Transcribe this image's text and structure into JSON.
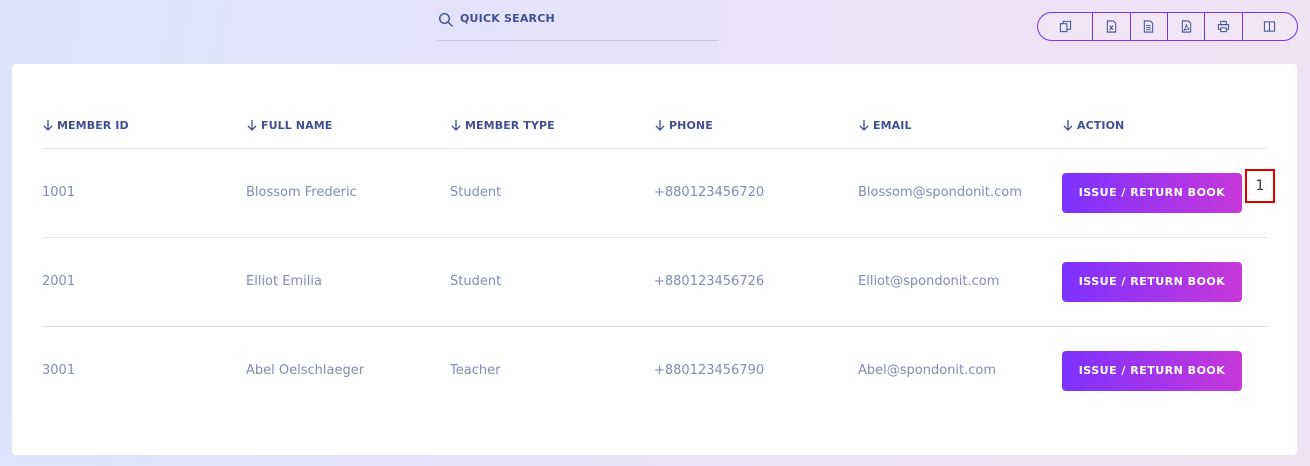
{
  "search": {
    "placeholder": "QUICK SEARCH"
  },
  "toolbar": {
    "buttons": [
      "copy-icon",
      "excel-icon",
      "csv-icon",
      "pdf-icon",
      "print-icon",
      "columns-icon"
    ]
  },
  "table": {
    "headers": [
      "MEMBER ID",
      "FULL NAME",
      "MEMBER TYPE",
      "PHONE",
      "EMAIL",
      "ACTION"
    ],
    "rows": [
      {
        "id": "1001",
        "name": "Blossom Frederic",
        "type": "Student",
        "phone": "+880123456720",
        "email": "Blossom@spondonit.com",
        "action": "ISSUE / RETURN BOOK"
      },
      {
        "id": "2001",
        "name": "Elliot Emilia",
        "type": "Student",
        "phone": "+880123456726",
        "email": "Elliot@spondonit.com",
        "action": "ISSUE / RETURN BOOK"
      },
      {
        "id": "3001",
        "name": "Abel Oelschlaeger",
        "type": "Teacher",
        "phone": "+880123456790",
        "email": "Abel@spondonit.com",
        "action": "ISSUE / RETURN BOOK"
      }
    ]
  },
  "annotation": {
    "label": "1"
  },
  "colors": {
    "accent": "#7c32ff",
    "accent_end": "#c738d8",
    "header_text": "#415094",
    "cell_text": "#828bb2",
    "marker": "#e00000"
  }
}
